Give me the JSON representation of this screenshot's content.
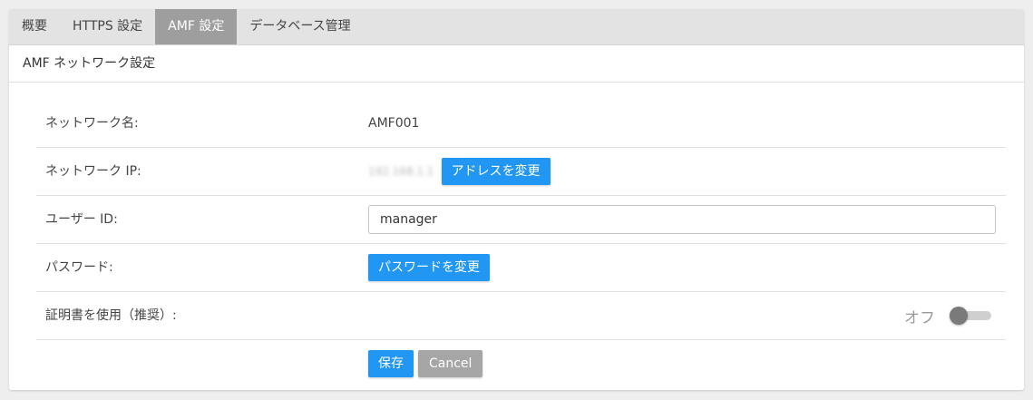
{
  "tabs": [
    {
      "label": "概要",
      "active": false
    },
    {
      "label": "HTTPS 設定",
      "active": false
    },
    {
      "label": "AMF 設定",
      "active": true
    },
    {
      "label": "データベース管理",
      "active": false
    }
  ],
  "section": {
    "title": "AMF ネットワーク設定"
  },
  "form": {
    "network_name": {
      "label": "ネットワーク名:",
      "value": "AMF001"
    },
    "network_ip": {
      "label": "ネットワーク IP:",
      "value": "192.168.1.1",
      "button": "アドレスを変更"
    },
    "user_id": {
      "label": "ユーザー ID:",
      "value": "manager",
      "placeholder": ""
    },
    "password": {
      "label": "パスワード:",
      "button": "パスワードを変更"
    },
    "certificate": {
      "label": "証明書を使用（推奨）:",
      "toggle_text": "オフ",
      "enabled": false
    },
    "actions": {
      "save": "保存",
      "cancel": "Cancel"
    }
  },
  "colors": {
    "primary": "#2196f3",
    "tab_active": "#9e9e9e",
    "secondary_button": "#a6a6a6"
  }
}
